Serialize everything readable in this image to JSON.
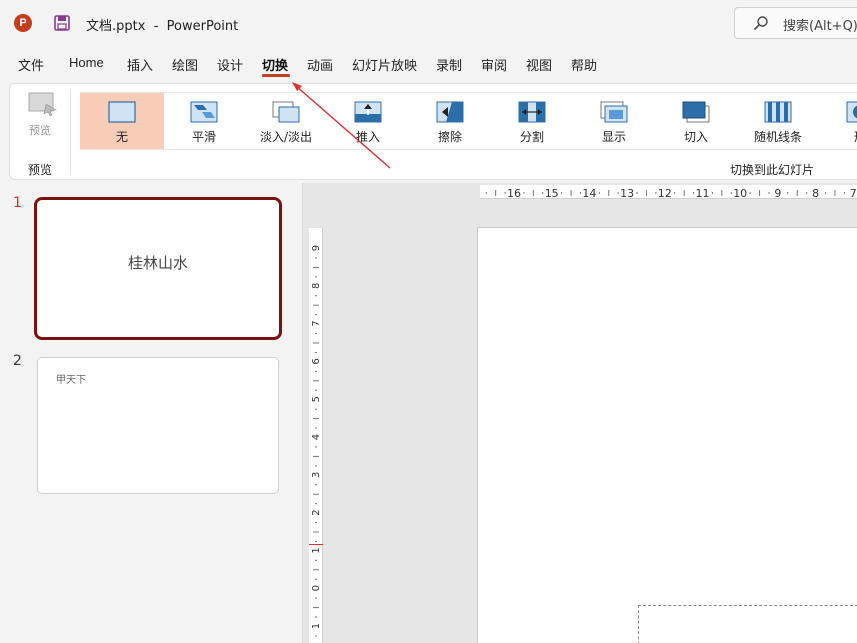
{
  "titlebar": {
    "app_letter": "P",
    "filename": "文档.pptx",
    "separator": "-",
    "app_name": "PowerPoint",
    "search_placeholder": "搜索(Alt+Q)"
  },
  "tabs": [
    {
      "label": "文件",
      "active": false
    },
    {
      "label": "Home",
      "active": false
    },
    {
      "label": "插入",
      "active": false
    },
    {
      "label": "绘图",
      "active": false
    },
    {
      "label": "设计",
      "active": false
    },
    {
      "label": "切换",
      "active": true
    },
    {
      "label": "动画",
      "active": false
    },
    {
      "label": "幻灯片放映",
      "active": false
    },
    {
      "label": "录制",
      "active": false
    },
    {
      "label": "审阅",
      "active": false
    },
    {
      "label": "视图",
      "active": false
    },
    {
      "label": "帮助",
      "active": false
    }
  ],
  "ribbon": {
    "preview_button": "预览",
    "preview_group": "预览",
    "transitions_group": "切换到此幻灯片",
    "transitions": [
      {
        "label": "无",
        "icon": "none-transition-icon",
        "selected": true
      },
      {
        "label": "平滑",
        "icon": "morph-transition-icon",
        "selected": false
      },
      {
        "label": "淡入/淡出",
        "icon": "fade-transition-icon",
        "selected": false
      },
      {
        "label": "推入",
        "icon": "push-transition-icon",
        "selected": false
      },
      {
        "label": "擦除",
        "icon": "wipe-transition-icon",
        "selected": false
      },
      {
        "label": "分割",
        "icon": "split-transition-icon",
        "selected": false
      },
      {
        "label": "显示",
        "icon": "reveal-transition-icon",
        "selected": false
      },
      {
        "label": "切入",
        "icon": "cut-transition-icon",
        "selected": false
      },
      {
        "label": "随机线条",
        "icon": "random-bars-transition-icon",
        "selected": false
      },
      {
        "label": "形",
        "icon": "shape-transition-icon",
        "selected": false
      }
    ]
  },
  "slides": [
    {
      "number": "1",
      "text": "桂林山水",
      "selected": true
    },
    {
      "number": "2",
      "text": "甲天下",
      "selected": false
    }
  ],
  "rulers": {
    "horizontal": [
      "16",
      "15",
      "14",
      "13",
      "12",
      "11",
      "10",
      "9",
      "8",
      "7"
    ],
    "vertical": [
      "9",
      "8",
      "7",
      "6",
      "5",
      "4",
      "3",
      "2",
      "1",
      "0",
      "1"
    ]
  },
  "colors": {
    "accent": "#c43e1c",
    "selected_transition_bg": "#f9ccb8",
    "selected_slide_border": "#7a1212",
    "annotation_arrow": "#e03030"
  }
}
